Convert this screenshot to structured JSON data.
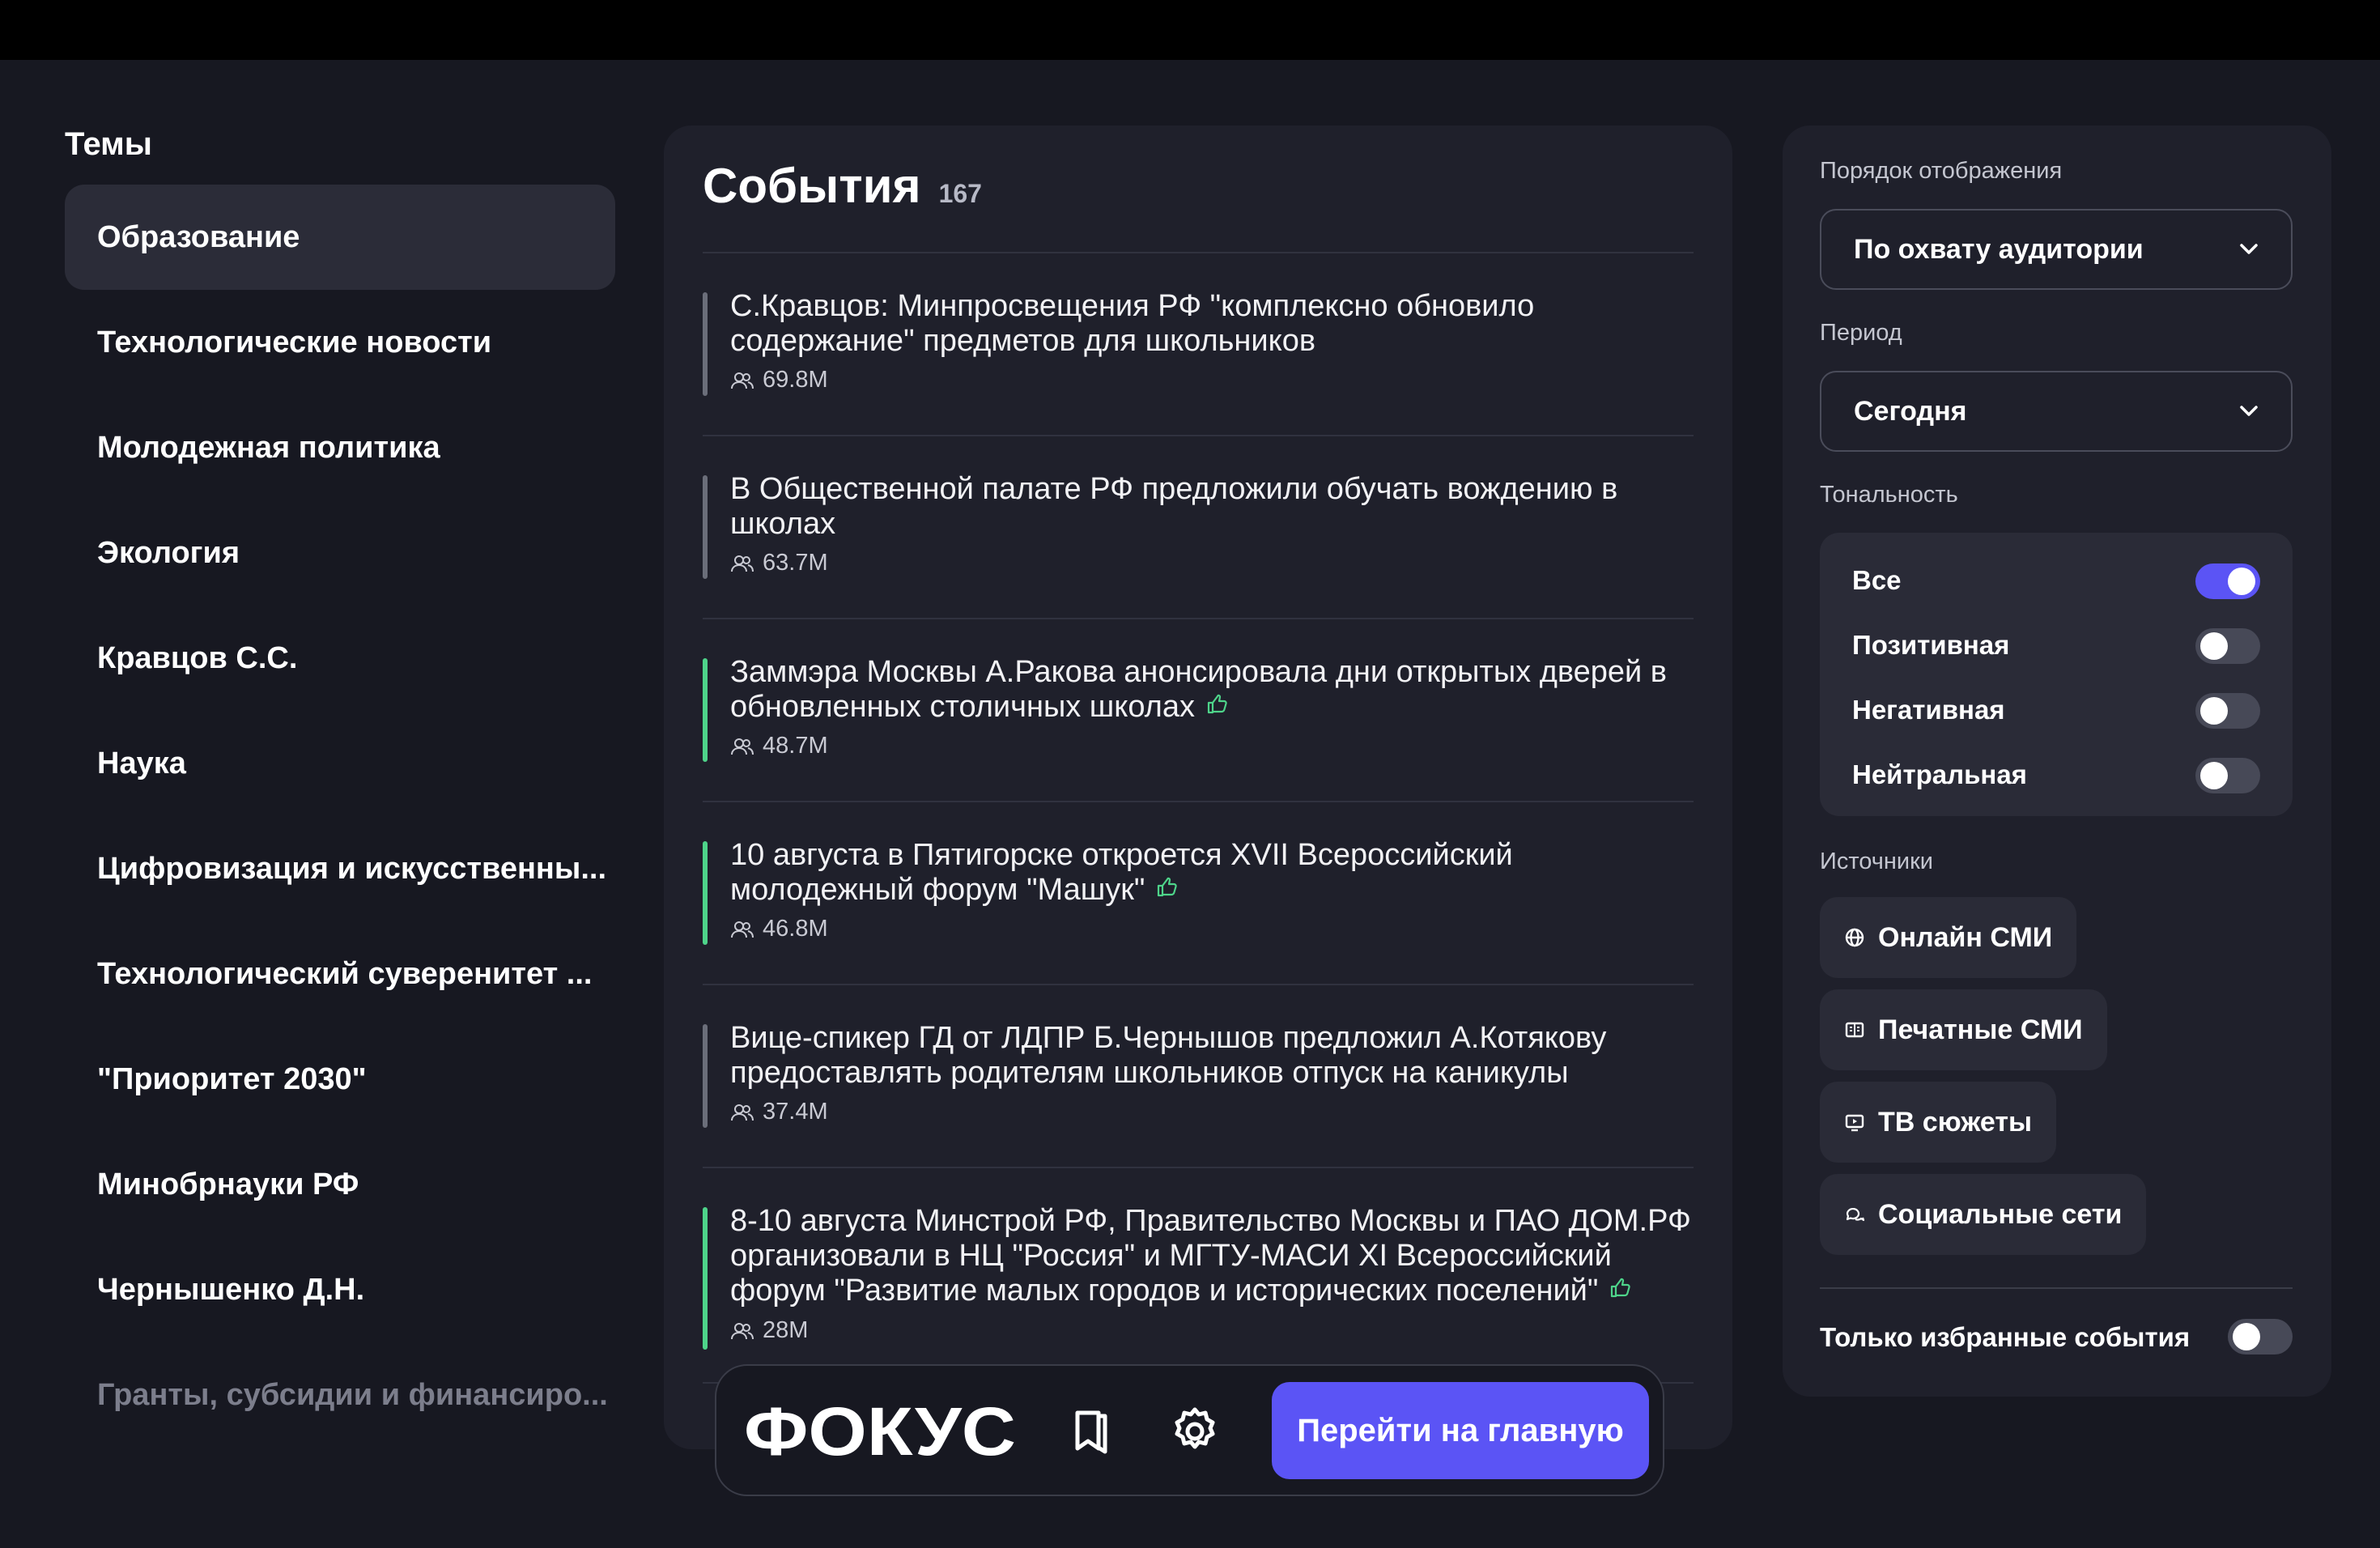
{
  "topics": {
    "title": "Темы",
    "items": [
      {
        "label": "Образование"
      },
      {
        "label": "Технологические новости"
      },
      {
        "label": "Молодежная политика"
      },
      {
        "label": "Экология"
      },
      {
        "label": "Кравцов С.С."
      },
      {
        "label": "Наука"
      },
      {
        "label": "Цифровизация и искусственны..."
      },
      {
        "label": "Технологический суверенитет ..."
      },
      {
        "label": "\"Приоритет 2030\""
      },
      {
        "label": "Минобрнауки РФ"
      },
      {
        "label": "Чернышенко Д.Н."
      },
      {
        "label": "Гранты, субсидии и финансиро..."
      }
    ]
  },
  "events": {
    "title": "События",
    "count": "167",
    "items": [
      {
        "text": "С.Кравцов: Минпросвещения РФ \"комплексно обновило содержание\" предметов для школьников",
        "reach": "69.8M",
        "tone": "neutral"
      },
      {
        "text": "В Общественной палате РФ предложили обучать вождению в школах",
        "reach": "63.7M",
        "tone": "neutral"
      },
      {
        "text": "Заммэра Москвы А.Ракова анонсировала дни открытых дверей в обновленных столичных школах",
        "reach": "48.7M",
        "tone": "positive"
      },
      {
        "text": "10 августа в Пятигорске откроется XVII Всероссийский молодежный форум \"Машук\"",
        "reach": "46.8M",
        "tone": "positive"
      },
      {
        "text": "Вице-спикер ГД от ЛДПР Б.Чернышов предложил А.Котякову предоставлять родителям школьников отпуск на каникулы",
        "reach": "37.4M",
        "tone": "neutral"
      },
      {
        "text": "8-10 августа Минстрой РФ, Правительство Москвы и ПАО ДОМ.РФ организовали в НЦ \"Россия\" и МГТУ-МАСИ XI Всероссийский форум \"Развитие малых городов и исторических поселений\"",
        "reach": "28M",
        "tone": "positive"
      }
    ]
  },
  "dock": {
    "logo_text": "ФОКУС",
    "home_button": "Перейти на главную",
    "bookmark_icon": "bookmark-icon",
    "settings_icon": "gear-icon"
  },
  "filters": {
    "order_label": "Порядок отображения",
    "order_value": "По охвату аудитории",
    "period_label": "Период",
    "period_value": "Сегодня",
    "tone_label": "Тональность",
    "tones": [
      {
        "label": "Все",
        "on": true
      },
      {
        "label": "Позитивная",
        "on": false
      },
      {
        "label": "Негативная",
        "on": false
      },
      {
        "label": "Нейтральная",
        "on": false
      }
    ],
    "sources_label": "Источники",
    "sources": [
      {
        "label": "Онлайн СМИ",
        "icon": "globe-icon"
      },
      {
        "label": "Печатные СМИ",
        "icon": "newspaper-icon"
      },
      {
        "label": "ТВ сюжеты",
        "icon": "tv-icon"
      },
      {
        "label": "Социальные сети",
        "icon": "chat-icon"
      }
    ],
    "favorites_label": "Только избранные события",
    "favorites_on": false
  },
  "colors": {
    "background": "#171821",
    "panel": "#1f202b",
    "accent": "#5b54f5",
    "positive": "#4ed48a",
    "neutral": "#6b6e7a"
  }
}
